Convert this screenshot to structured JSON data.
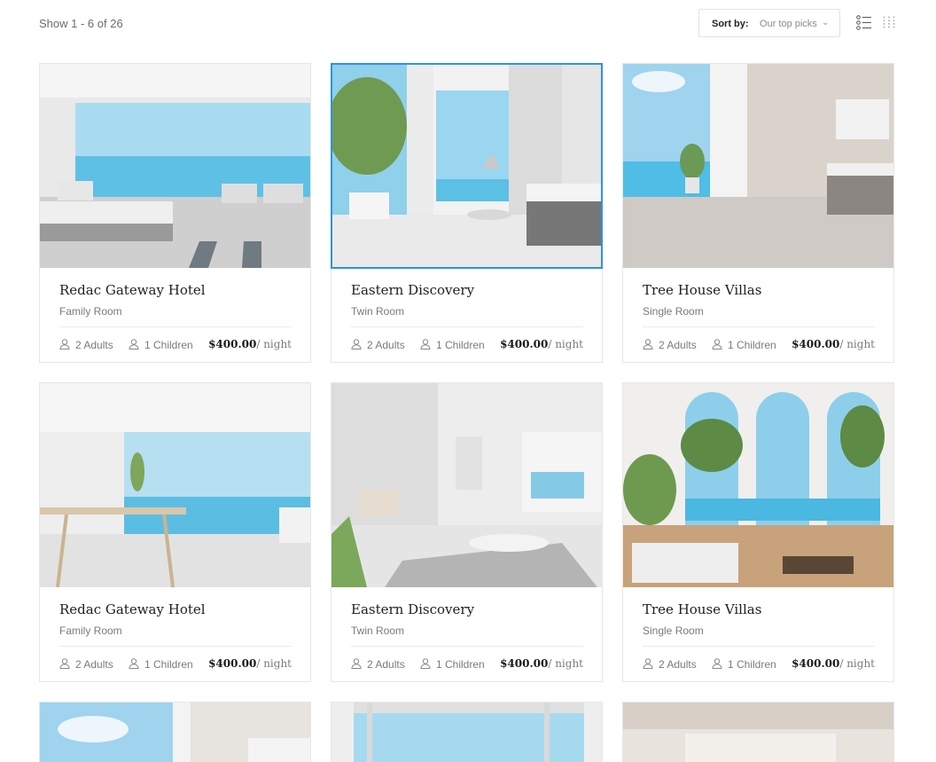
{
  "toolbar": {
    "show_count": "Show 1 - 6 of 26",
    "sort_label": "Sort by:",
    "sort_value": "Our top picks"
  },
  "listings": [
    {
      "title": "Redac Gateway Hotel",
      "room": "Family Room",
      "adults": "2 Adults",
      "children": "1 Children",
      "price": "$400.00",
      "unit": "/ night"
    },
    {
      "title": "Eastern Discovery",
      "room": "Twin Room",
      "adults": "2 Adults",
      "children": "1 Children",
      "price": "$400.00",
      "unit": "/ night"
    },
    {
      "title": "Tree House Villas",
      "room": "Single Room",
      "adults": "2 Adults",
      "children": "1 Children",
      "price": "$400.00",
      "unit": "/ night"
    },
    {
      "title": "Redac Gateway Hotel",
      "room": "Family Room",
      "adults": "2 Adults",
      "children": "1 Children",
      "price": "$400.00",
      "unit": "/ night"
    },
    {
      "title": "Eastern Discovery",
      "room": "Twin Room",
      "adults": "2 Adults",
      "children": "1 Children",
      "price": "$400.00",
      "unit": "/ night"
    },
    {
      "title": "Tree House Villas",
      "room": "Single Room",
      "adults": "2 Adults",
      "children": "1 Children",
      "price": "$400.00",
      "unit": "/ night"
    }
  ],
  "colors": {
    "accent": "#2f92e0",
    "border": "#e6e6e6",
    "sea": "#5fc0e6",
    "sky": "#a9dcf2"
  }
}
